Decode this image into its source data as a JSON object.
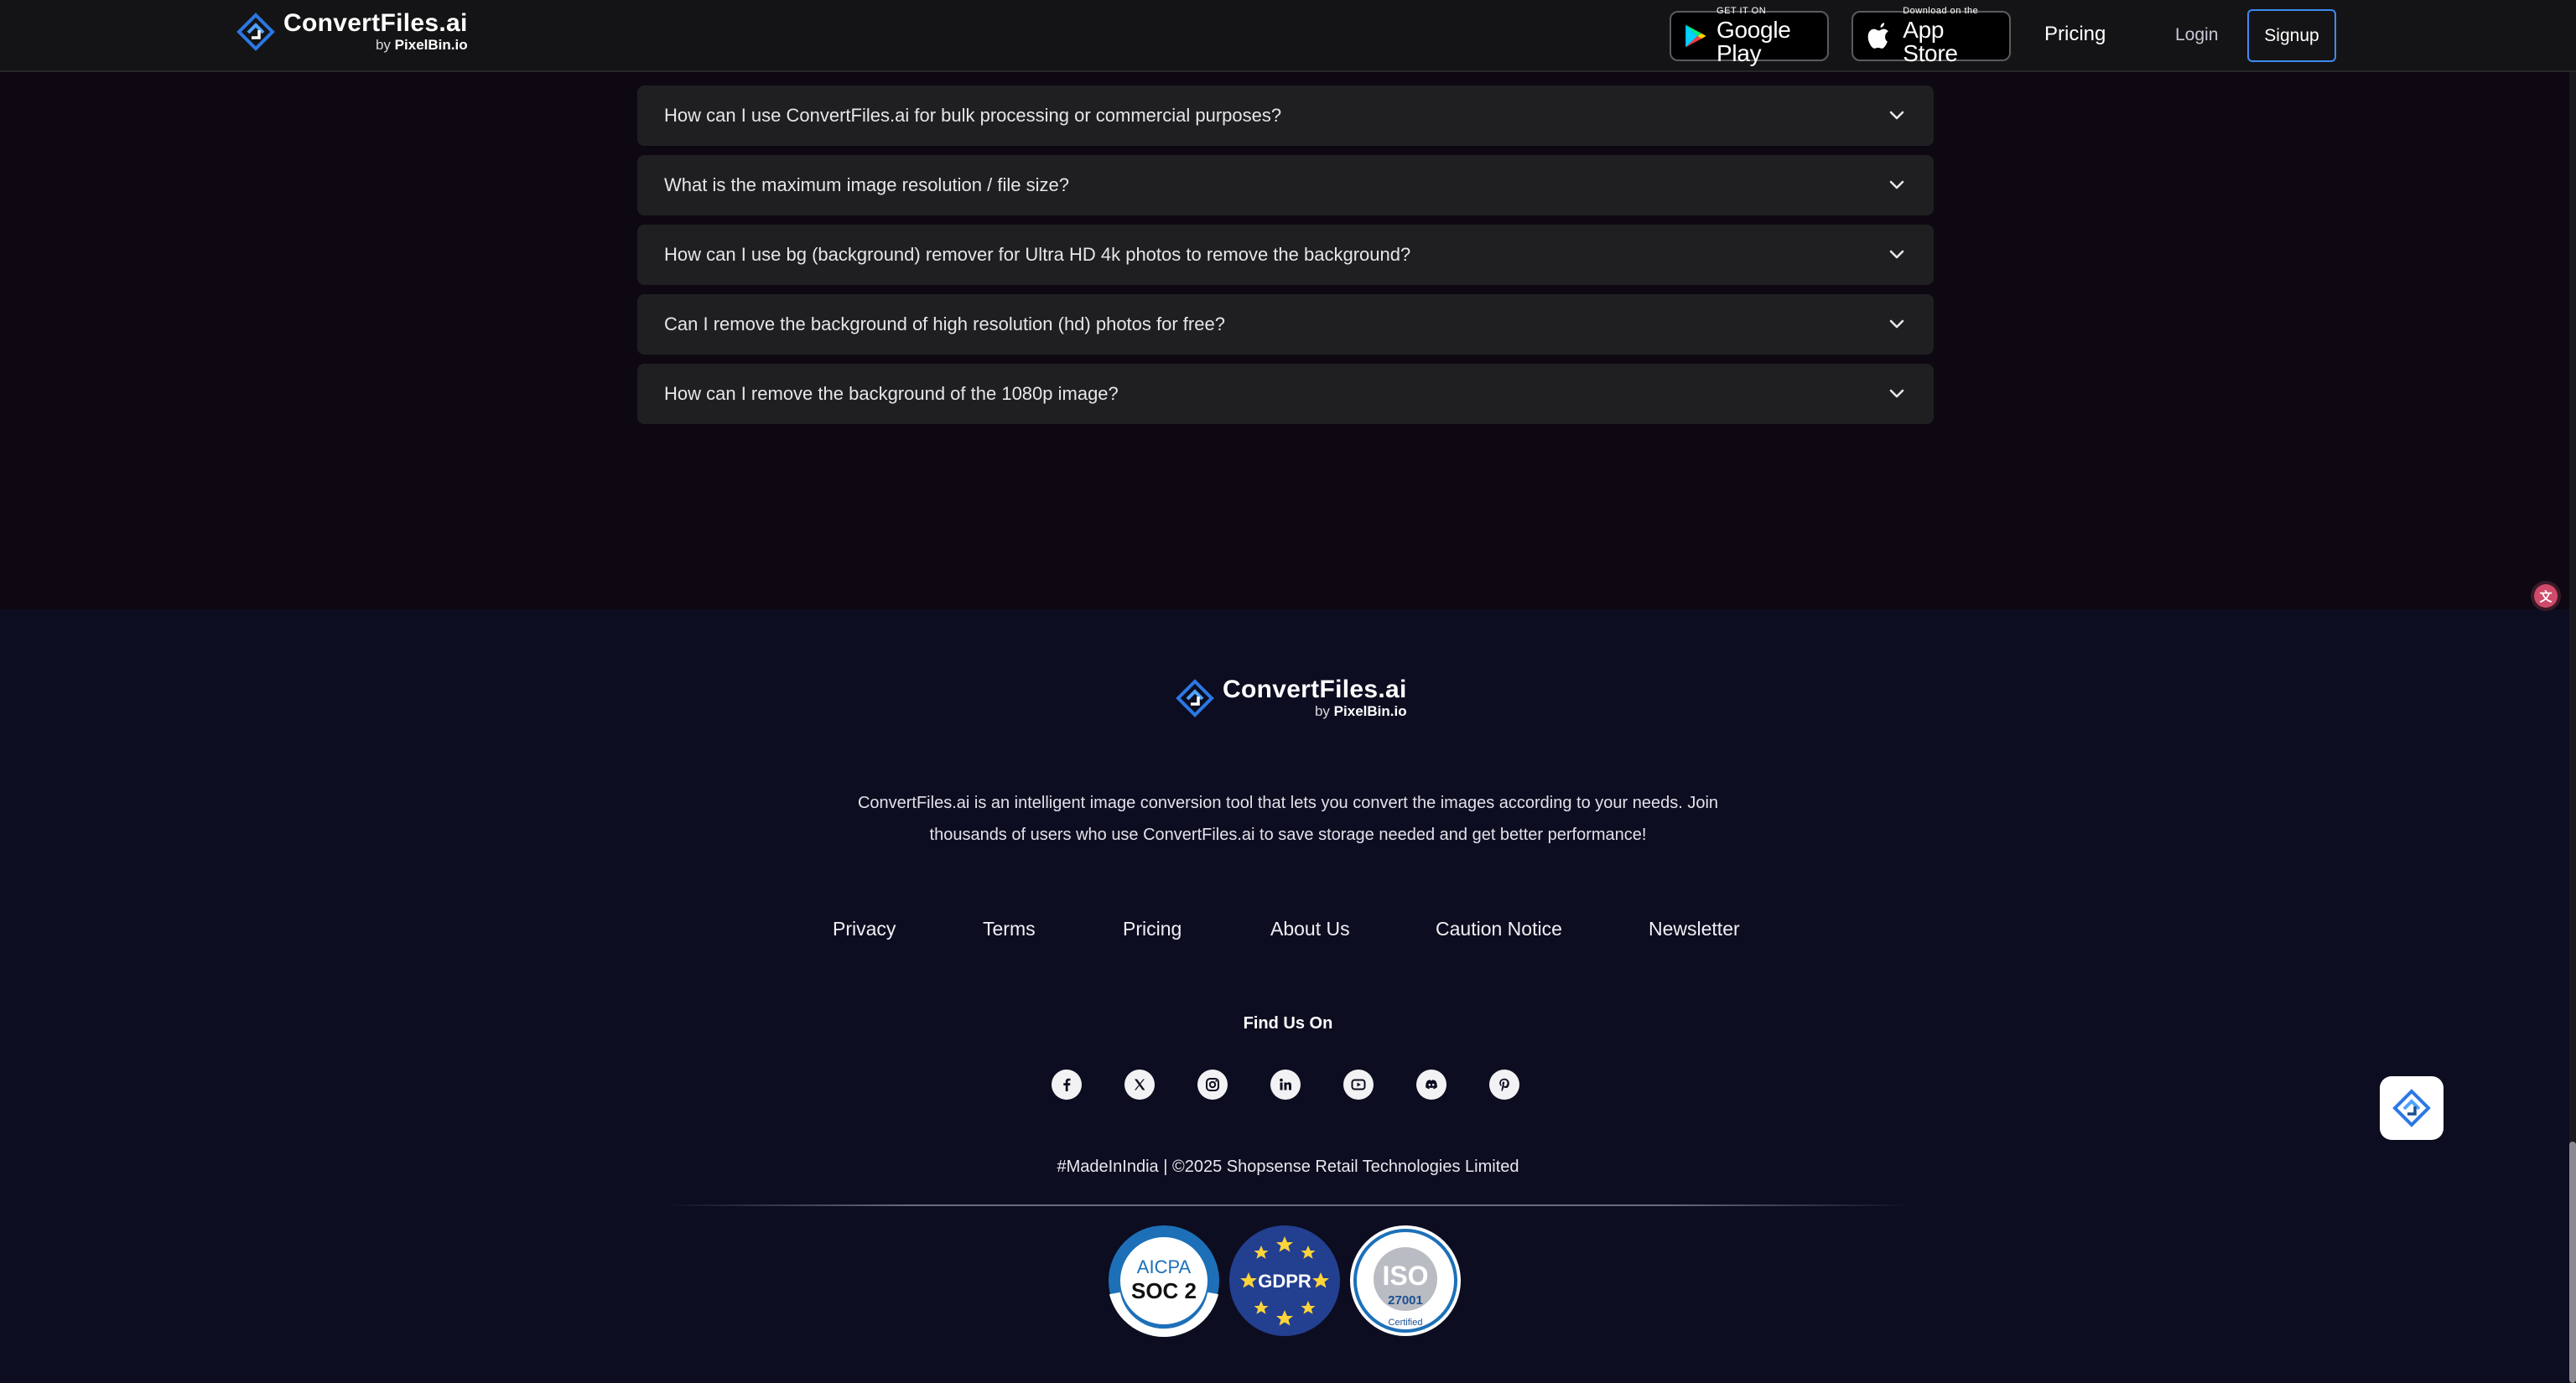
{
  "header": {
    "brand": {
      "name": "ConvertFiles",
      "name_suffix": ".ai",
      "by": "by",
      "by_brand": "PixelBin.io"
    },
    "google_play": {
      "small": "GET IT ON",
      "big": "Google Play"
    },
    "app_store": {
      "small": "Download on the",
      "big": "App Store"
    },
    "nav": {
      "pricing": "Pricing",
      "login": "Login",
      "signup": "Signup"
    }
  },
  "faq": {
    "items": [
      {
        "question": "How can I use ConvertFiles.ai for bulk processing or commercial purposes?"
      },
      {
        "question": "What is the maximum image resolution / file size?"
      },
      {
        "question": "How can I use bg (background) remover for Ultra HD 4k photos to remove the background?"
      },
      {
        "question": "Can I remove the background of high resolution (hd) photos for free?"
      },
      {
        "question": "How can I remove the background of the 1080p image?"
      }
    ]
  },
  "footer": {
    "brand": {
      "name": "ConvertFiles",
      "name_suffix": ".ai",
      "by": "by",
      "by_brand": "PixelBin.io"
    },
    "description": "ConvertFiles.ai is an intelligent image conversion tool that lets you convert the images according to your needs. Join thousands of users who use ConvertFiles.ai to save storage needed and get better performance!",
    "links": [
      "Privacy",
      "Terms",
      "Pricing",
      "About Us",
      "Caution Notice",
      "Newsletter"
    ],
    "find_us": "Find Us On",
    "social": [
      "facebook-icon",
      "x-twitter-icon",
      "instagram-icon",
      "linkedin-icon",
      "youtube-icon",
      "discord-icon",
      "pinterest-icon"
    ],
    "copyright": "#MadeInIndia | ©2025 Shopsense Retail Technologies Limited",
    "badges": {
      "soc2": {
        "top": "AICPA",
        "main": "SOC 2"
      },
      "gdpr": {
        "main": "GDPR"
      },
      "iso": {
        "main": "ISO",
        "number": "27001",
        "certified": "Certified"
      }
    }
  },
  "colors": {
    "page_bg": "#0d0812",
    "footer_bg": "#0c0d20",
    "faq_item_bg": "#1f1f21",
    "accent": "#3d8bf0"
  }
}
